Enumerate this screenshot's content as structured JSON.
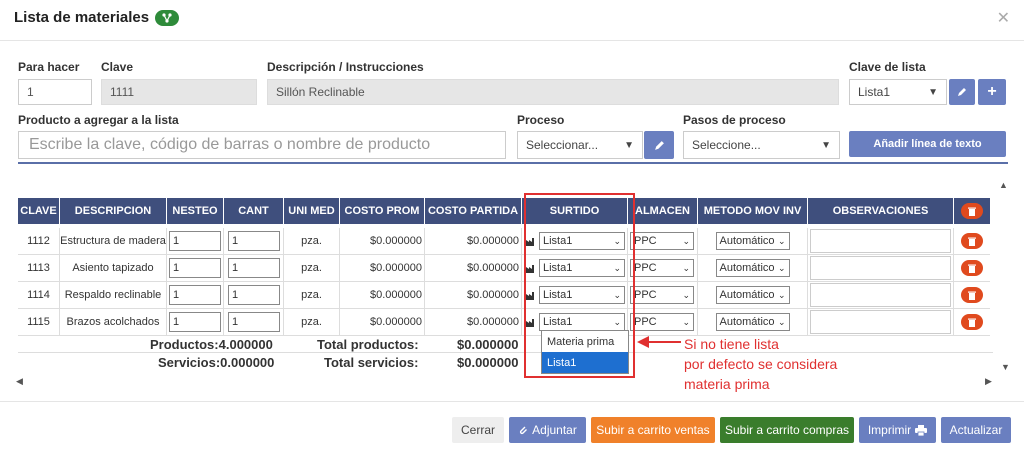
{
  "header": {
    "title": "Lista de materiales"
  },
  "form": {
    "para_hacer_label": "Para hacer",
    "para_hacer_value": "1",
    "clave_label": "Clave",
    "clave_value": "1111",
    "descripcion_label": "Descripción / Instrucciones",
    "descripcion_value": "Sillón Reclinable",
    "clave_lista_label": "Clave de lista",
    "clave_lista_value": "Lista1",
    "producto_label": "Producto a agregar a la lista",
    "producto_placeholder": "Escribe la clave, código de barras o nombre de producto",
    "proceso_label": "Proceso",
    "proceso_value": "Seleccionar...",
    "pasos_label": "Pasos de proceso",
    "pasos_value": "Seleccione...",
    "add_text_line": "Añadir línea de texto"
  },
  "table": {
    "headers": [
      "CLAVE",
      "DESCRIPCION",
      "NESTEO",
      "CANT",
      "UNI MED",
      "COSTO PROM",
      "COSTO PARTIDA",
      "SURTIDO",
      "ALMACEN",
      "METODO MOV INV",
      "OBSERVACIONES"
    ],
    "rows": [
      {
        "clave": "1112",
        "descripcion": "Estructura de madera",
        "nesteo": "1",
        "cant": "1",
        "uni_med": "pza.",
        "costo_prom": "$0.000000",
        "costo_partida": "$0.000000",
        "surtido": "Lista1",
        "almacen": "PPC",
        "metodo": "Automático",
        "observaciones": ""
      },
      {
        "clave": "1113",
        "descripcion": "Asiento tapizado",
        "nesteo": "1",
        "cant": "1",
        "uni_med": "pza.",
        "costo_prom": "$0.000000",
        "costo_partida": "$0.000000",
        "surtido": "Lista1",
        "almacen": "PPC",
        "metodo": "Automático",
        "observaciones": ""
      },
      {
        "clave": "1114",
        "descripcion": "Respaldo reclinable",
        "nesteo": "1",
        "cant": "1",
        "uni_med": "pza.",
        "costo_prom": "$0.000000",
        "costo_partida": "$0.000000",
        "surtido": "Lista1",
        "almacen": "PPC",
        "metodo": "Automático",
        "observaciones": ""
      },
      {
        "clave": "1115",
        "descripcion": "Brazos acolchados",
        "nesteo": "1",
        "cant": "1",
        "uni_med": "pza.",
        "costo_prom": "$0.000000",
        "costo_partida": "$0.000000",
        "surtido": "Lista1",
        "almacen": "PPC",
        "metodo": "Automático",
        "observaciones": ""
      }
    ],
    "totals": {
      "productos_label": "Productos:",
      "productos_value": "4.000000",
      "servicios_label": "Servicios:",
      "servicios_value": "0.000000",
      "total_productos_label": "Total productos:",
      "total_productos_value": "$0.000000",
      "total_servicios_label": "Total servicios:",
      "total_servicios_value": "$0.000000"
    }
  },
  "dropdown": {
    "options": [
      "Materia prima",
      "Lista1"
    ],
    "selected": "Lista1"
  },
  "annotation": {
    "lines": [
      "Si no tiene lista",
      "por defecto se considera",
      "materia prima"
    ],
    "color": "#e03030"
  },
  "footer": {
    "cerrar": "Cerrar",
    "adjuntar": "Adjuntar",
    "carrito_ventas": "Subir a carrito ventas",
    "carrito_compras": "Subir a carrito compras",
    "imprimir": "Imprimir",
    "actualizar": "Actualizar"
  },
  "colors": {
    "header_bg": "#3f4f7d",
    "button_blue": "#6a7fc0",
    "orange": "#f0812a",
    "green": "#3a7d2c",
    "delete_red": "#e04a1e"
  }
}
